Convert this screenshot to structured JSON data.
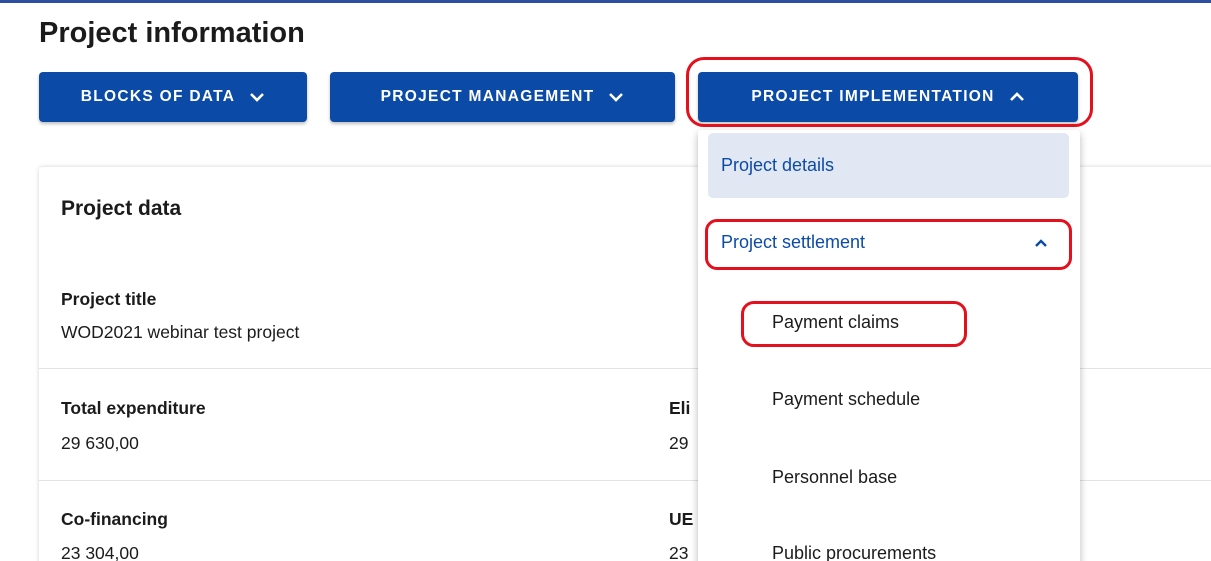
{
  "page_title": "Project information",
  "nav": {
    "blocks_of_data": "BLOCKS OF DATA",
    "project_management": "PROJECT MANAGEMENT",
    "project_implementation": "PROJECT IMPLEMENTATION"
  },
  "card": {
    "title": "Project data",
    "project_title_label": "Project title",
    "project_title_value": "WOD2021 webinar test project",
    "total_expenditure_label": "Total expenditure",
    "total_expenditure_value": "29 630,00",
    "eligible_label_visible": "Eli",
    "eligible_value_visible": "29",
    "cofinancing_label": "Co-financing",
    "cofinancing_value": "23 304,00",
    "ue_label_visible": "UE",
    "ue_value_visible": "23"
  },
  "dropdown": {
    "project_details": "Project details",
    "project_settlement": "Project settlement",
    "items": [
      "Payment claims",
      "Payment schedule",
      "Personnel base",
      "Public procurements"
    ]
  },
  "colors": {
    "primary": "#0b4ba7",
    "highlight_annotation": "#e4101e",
    "active_item_bg": "#e1e8f4"
  }
}
